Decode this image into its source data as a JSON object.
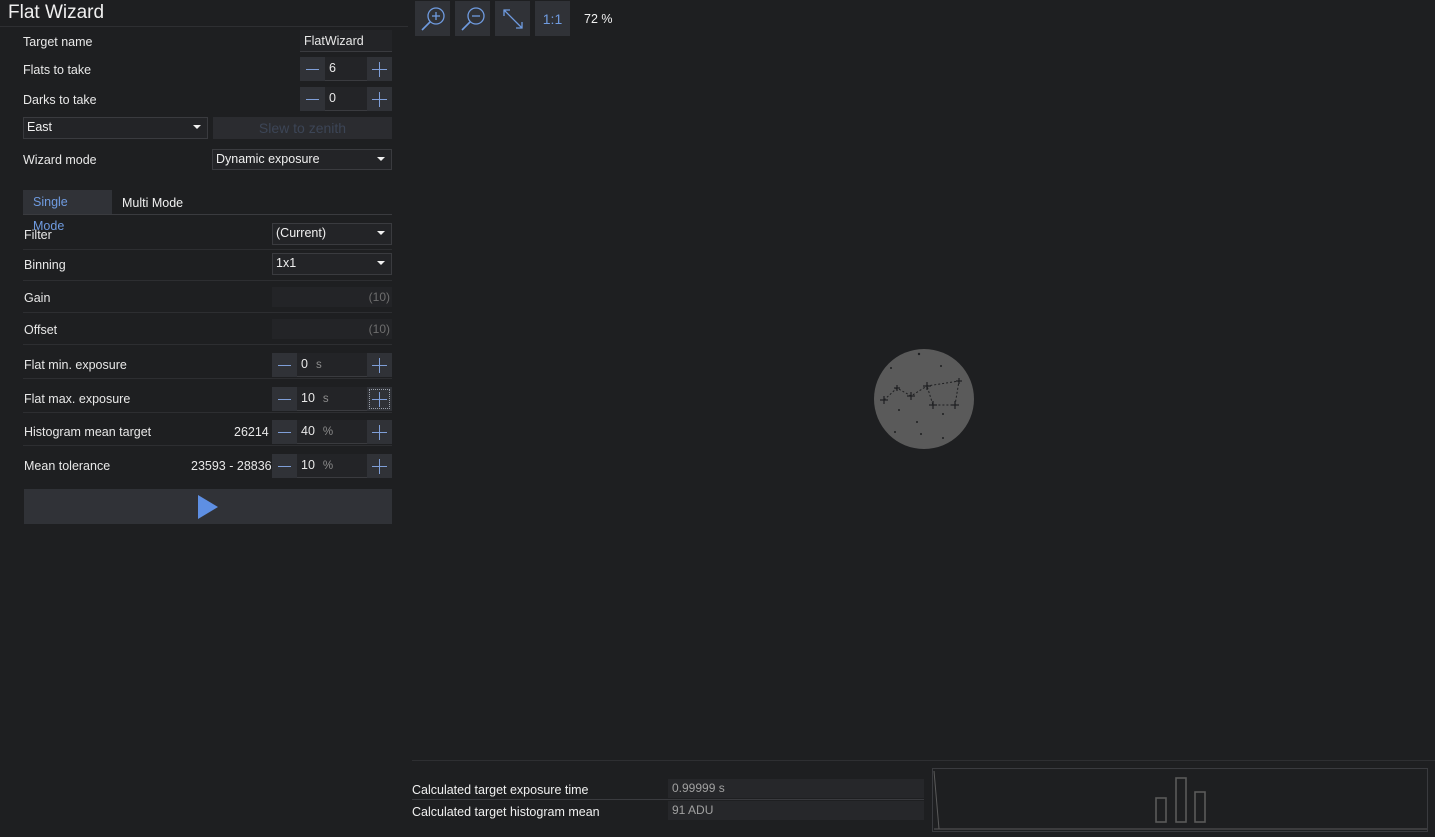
{
  "window": {
    "title": "Flat Wizard"
  },
  "general": {
    "target_name_label": "Target name",
    "target_name_value": "FlatWizard",
    "flats_label": "Flats to take",
    "flats_value": "6",
    "darks_label": "Darks to take",
    "darks_value": "0",
    "direction_value": "East",
    "slew_button_label": "Slew to zenith",
    "wizard_mode_label": "Wizard mode",
    "wizard_mode_value": "Dynamic exposure"
  },
  "tabs": [
    {
      "label": "Single Mode",
      "active": true
    },
    {
      "label": "Multi Mode",
      "active": false
    }
  ],
  "single_mode": {
    "filter_label": "Filter",
    "filter_value": "(Current)",
    "binning_label": "Binning",
    "binning_value": "1x1",
    "gain_label": "Gain",
    "gain_value": "(10)",
    "offset_label": "Offset",
    "offset_value": "(10)",
    "min_exposure_label": "Flat min. exposure",
    "min_exposure_value": "0",
    "min_exposure_unit": "s",
    "max_exposure_label": "Flat max. exposure",
    "max_exposure_value": "10",
    "max_exposure_unit": "s",
    "histogram_label": "Histogram mean target",
    "histogram_adu": "26214",
    "histogram_value": "40",
    "histogram_unit": "%",
    "tolerance_label": "Mean tolerance",
    "tolerance_range": "23593 - 28836",
    "tolerance_value": "10",
    "tolerance_unit": "%"
  },
  "toolbar": {
    "zoom_in_icon": "zoom-in-icon",
    "zoom_out_icon": "zoom-out-icon",
    "fit_icon": "fit-to-screen-icon",
    "one_to_one_label": "1:1",
    "zoom_level": "72 %"
  },
  "results": {
    "exposure_label": "Calculated target exposure time",
    "exposure_value": "0.99999 s",
    "mean_label": "Calculated target histogram mean",
    "mean_value": "91 ADU"
  },
  "colors": {
    "background": "#1e1f21",
    "accent": "#6f9be0",
    "button": "#303237"
  }
}
